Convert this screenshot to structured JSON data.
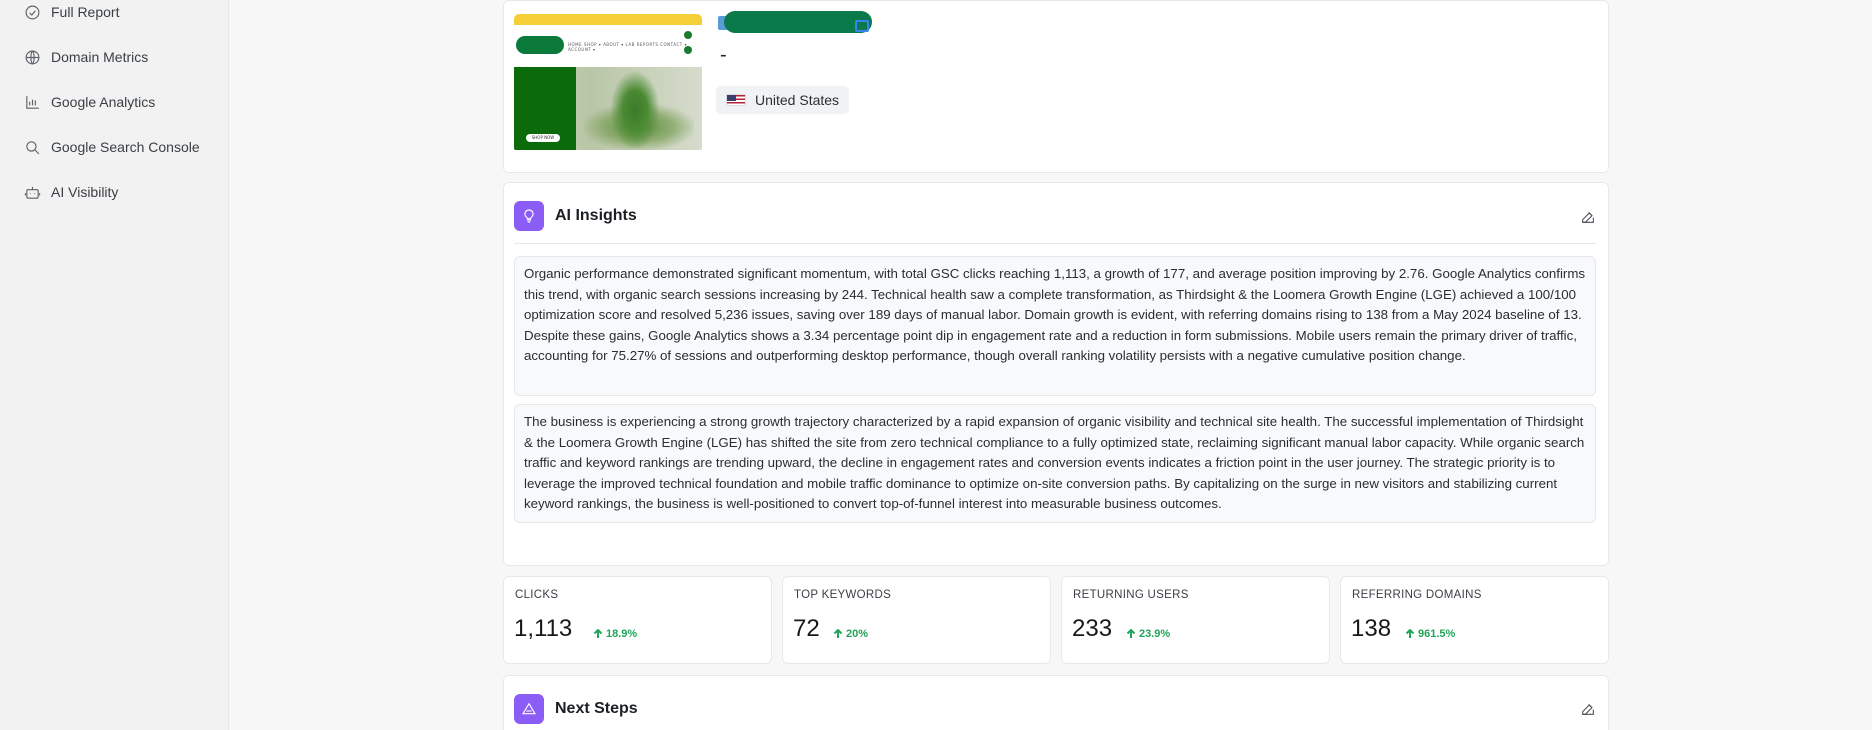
{
  "sidebar": {
    "items": [
      {
        "label": "Full Report",
        "icon": "check-circle-icon"
      },
      {
        "label": "Domain Metrics",
        "icon": "globe-icon"
      },
      {
        "label": "Google Analytics",
        "icon": "bar-chart-icon"
      },
      {
        "label": "Google Search Console",
        "icon": "search-icon"
      },
      {
        "label": "AI Visibility",
        "icon": "robot-icon"
      }
    ]
  },
  "site": {
    "title": "-",
    "country": "United States",
    "thumbnail_button": "SHOP NOW",
    "thumbnail_nav": "HOME  SHOP ▾  ABOUT ▾  LAB REPORTS  CONTACT ▾  ACCOUNT ▾"
  },
  "ai_insights": {
    "title": "AI Insights",
    "paragraphs": [
      "Organic performance demonstrated significant momentum, with total GSC clicks reaching 1,113, a growth of 177, and average position improving by 2.76. Google Analytics confirms this trend, with organic search sessions increasing by 244. Technical health saw a complete transformation, as Thirdsight & the Loomera Growth Engine (LGE) achieved a 100/100 optimization score and resolved 5,236 issues, saving over 189 days of manual labor. Domain growth is evident, with referring domains rising to 138 from a May 2024 baseline of 13. Despite these gains, Google Analytics shows a 3.34 percentage point dip in engagement rate and a reduction in form submissions. Mobile users remain the primary driver of traffic, accounting for 75.27% of sessions and outperforming desktop performance, though overall ranking volatility persists with a negative cumulative position change.",
      "The business is experiencing a strong growth trajectory characterized by a rapid expansion of organic visibility and technical site health. The successful implementation of Thirdsight & the Loomera Growth Engine (LGE) has shifted the site from zero technical compliance to a fully optimized state, reclaiming significant manual labor capacity. While organic search traffic and keyword rankings are trending upward, the decline in engagement rates and conversion events indicates a friction point in the user journey. The strategic priority is to leverage the improved technical foundation and mobile traffic dominance to optimize on-site conversion paths. By capitalizing on the surge in new visitors and stabilizing current keyword rankings, the business is well-positioned to convert top-of-funnel interest into measurable business outcomes."
    ]
  },
  "kpis": [
    {
      "label": "CLICKS",
      "value": "1,113",
      "delta": "18.9%"
    },
    {
      "label": "TOP KEYWORDS",
      "value": "72",
      "delta": "20%"
    },
    {
      "label": "RETURNING USERS",
      "value": "233",
      "delta": "23.9%"
    },
    {
      "label": "REFERRING DOMAINS",
      "value": "138",
      "delta": "961.5%"
    }
  ],
  "next_steps": {
    "title": "Next Steps"
  },
  "colors": {
    "accent": "#8b5cf6",
    "positive": "#22a55a"
  }
}
